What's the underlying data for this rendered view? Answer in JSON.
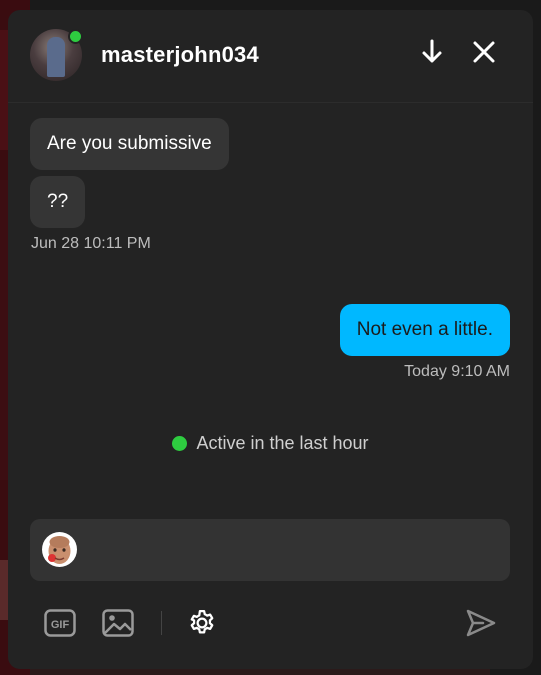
{
  "chat": {
    "username": "masterjohn034",
    "online": true
  },
  "messages": [
    {
      "direction": "incoming",
      "text": "Are you submissive"
    },
    {
      "direction": "incoming",
      "text": "??"
    },
    {
      "direction": "outgoing",
      "text": "Not even a little."
    }
  ],
  "timestamps": {
    "incoming_group": "Jun 28 10:11 PM",
    "outgoing_group": "Today 9:10 AM"
  },
  "status": {
    "text": "Active in the last hour",
    "color": "#2ecc40"
  },
  "composer": {
    "placeholder": "",
    "value": ""
  },
  "toolbar": {
    "gif_label": "GIF",
    "icons": [
      "gif-icon",
      "image-icon",
      "gear-icon",
      "send-icon"
    ]
  },
  "header_icons": [
    "arrow-down-icon",
    "close-icon"
  ],
  "colors": {
    "outgoing_bubble": "#00b8ff",
    "incoming_bubble": "#353535",
    "panel_bg": "#232323"
  }
}
